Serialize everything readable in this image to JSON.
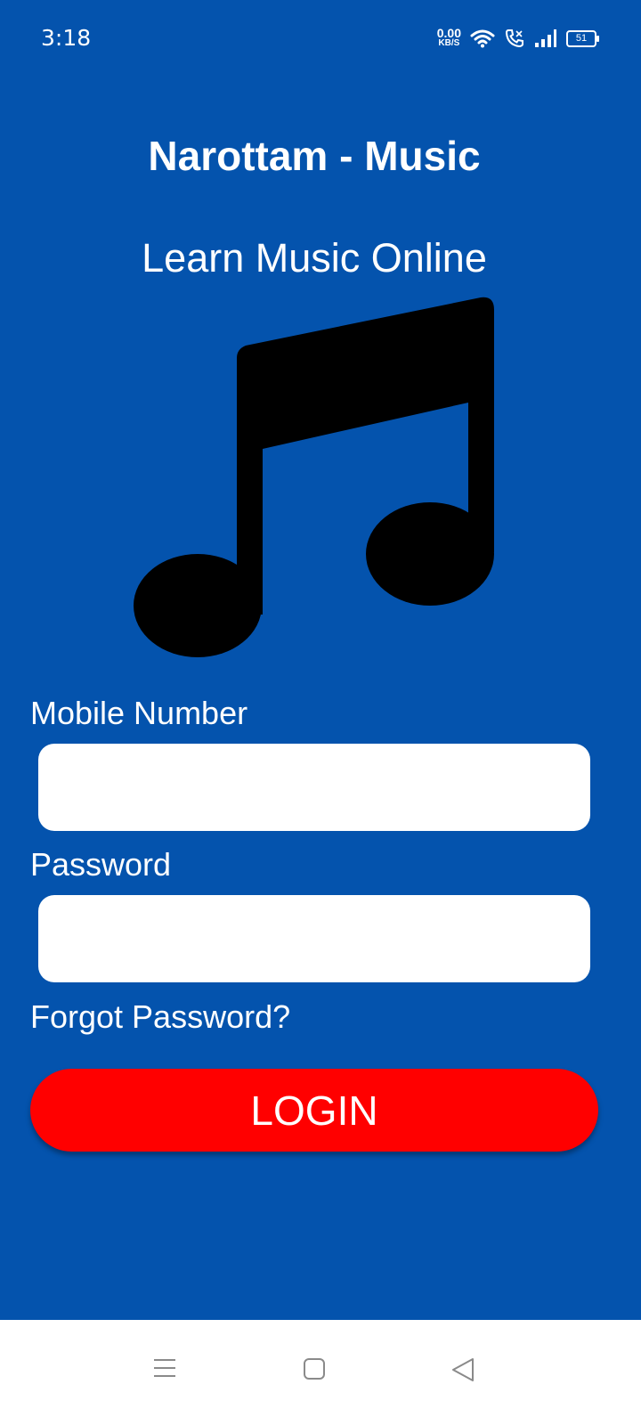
{
  "status_bar": {
    "time": "3:18",
    "net_speed_value": "0.00",
    "net_speed_unit": "KB/S",
    "battery_level": "51",
    "icons": [
      "wifi-icon",
      "volte-call-icon",
      "signal-icon",
      "battery-icon"
    ]
  },
  "app": {
    "title": "Narottam - Music",
    "subtitle": "Learn Music Online",
    "logo_icon": "music-note-icon"
  },
  "form": {
    "mobile_label": "Mobile Number",
    "mobile_value": "",
    "password_label": "Password",
    "password_value": "",
    "forgot_password": "Forgot Password?",
    "login_button": "LOGIN"
  },
  "nav_bar": {
    "items": [
      "menu-icon",
      "home-icon",
      "back-icon"
    ]
  },
  "colors": {
    "background": "#0453ad",
    "login_button": "#ff0000",
    "text": "#ffffff"
  }
}
